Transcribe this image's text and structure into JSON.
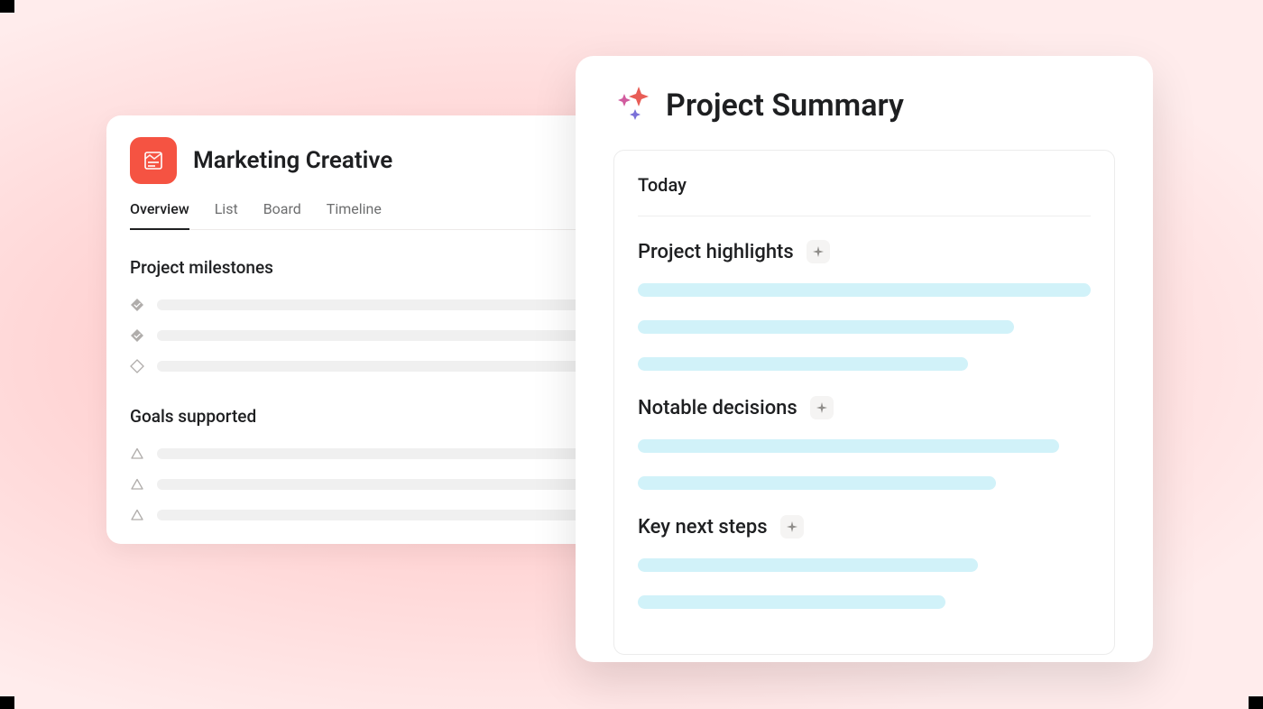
{
  "project": {
    "title": "Marketing Creative",
    "tabs": [
      {
        "label": "Overview",
        "active": true
      },
      {
        "label": "List",
        "active": false
      },
      {
        "label": "Board",
        "active": false
      },
      {
        "label": "Timeline",
        "active": false
      }
    ],
    "sections": {
      "milestones_heading": "Project milestones",
      "goals_heading": "Goals supported"
    }
  },
  "summary": {
    "title": "Project Summary",
    "date_label": "Today",
    "sections": [
      {
        "title": "Project highlights"
      },
      {
        "title": "Notable decisions"
      },
      {
        "title": "Key next steps"
      }
    ]
  }
}
